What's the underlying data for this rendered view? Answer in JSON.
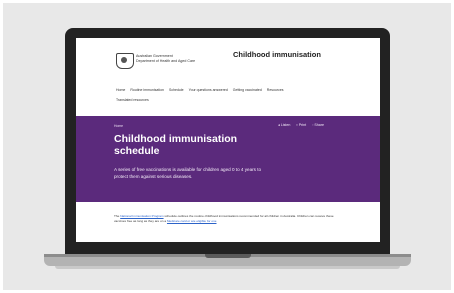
{
  "site": {
    "gov_line1": "Australian Government",
    "gov_line2": "Department of Health and Aged Care",
    "title": "Childhood immunisation"
  },
  "nav": {
    "row1": [
      "Home",
      "Routine immunisation",
      "Schedule",
      "Your questions answered",
      "Getting vaccinated",
      "Resources"
    ],
    "row2": [
      "Translated resources"
    ]
  },
  "hero": {
    "breadcrumb": "Home",
    "actions": [
      "Listen",
      "Print",
      "Share"
    ],
    "title": "Childhood immunisation schedule",
    "description": "A series of free vaccinations is available for children aged 0 to 4 years to protect them against serious diseases."
  },
  "intro": {
    "link1": "National Immunisation Program",
    "text1": " schedule outlines the routine childhood immunisations recommended for all children in Australia. Children can receive these vaccines free as long as they are on a ",
    "link2": "Medicare card or are eligible for one",
    "text0": "The "
  }
}
